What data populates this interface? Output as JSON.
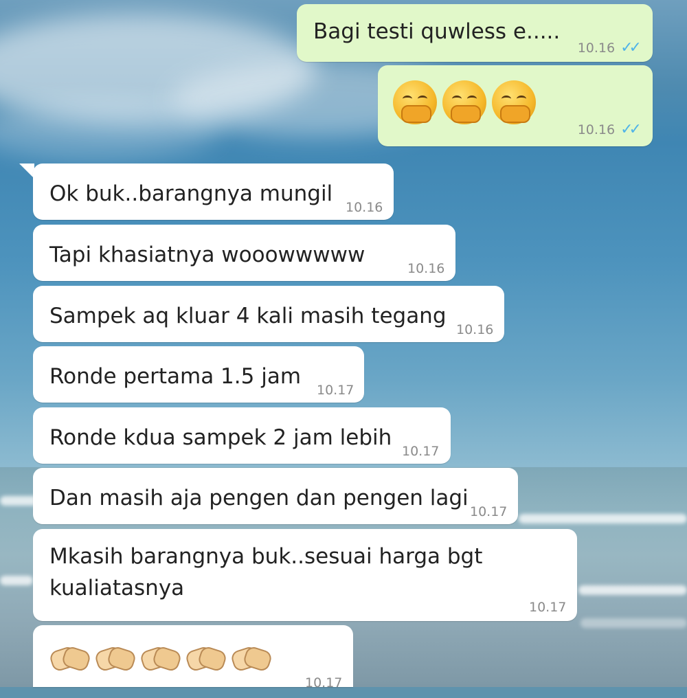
{
  "colors": {
    "incoming_bubble": "#ffffff",
    "outgoing_bubble": "#e1f8c9",
    "read_ticks": "#4fb3e8",
    "timestamp": "#8a8a8a"
  },
  "messages": [
    {
      "direction": "out",
      "text": "Bagi testi quwless e.....",
      "time": "10.16",
      "status": "read"
    },
    {
      "direction": "out",
      "emoji": [
        "hand-over-mouth-face-icon",
        "hand-over-mouth-face-icon",
        "hand-over-mouth-face-icon"
      ],
      "time": "10.16",
      "status": "read"
    },
    {
      "direction": "in",
      "text": "Ok buk..barangnya mungil",
      "time": "10.16"
    },
    {
      "direction": "in",
      "text": "Tapi khasiatnya wooowwwww",
      "time": "10.16"
    },
    {
      "direction": "in",
      "text": "Sampek aq kluar 4 kali masih tegang",
      "time": "10.16"
    },
    {
      "direction": "in",
      "text": "Ronde pertama 1.5 jam",
      "time": "10.17"
    },
    {
      "direction": "in",
      "text": "Ronde kdua sampek 2 jam lebih",
      "time": "10.17"
    },
    {
      "direction": "in",
      "text": "Dan masih aja pengen dan pengen lagi",
      "time": "10.17"
    },
    {
      "direction": "in",
      "text_lines": [
        "Mkasih barangnya buk..sesuai harga bgt",
        "kualiatasnya"
      ],
      "time": "10.17"
    },
    {
      "direction": "in",
      "emoji": [
        "handshake-icon",
        "handshake-icon",
        "handshake-icon",
        "handshake-icon",
        "handshake-icon"
      ],
      "time": "10.17"
    }
  ],
  "read_ticks_glyph": "✓✓"
}
